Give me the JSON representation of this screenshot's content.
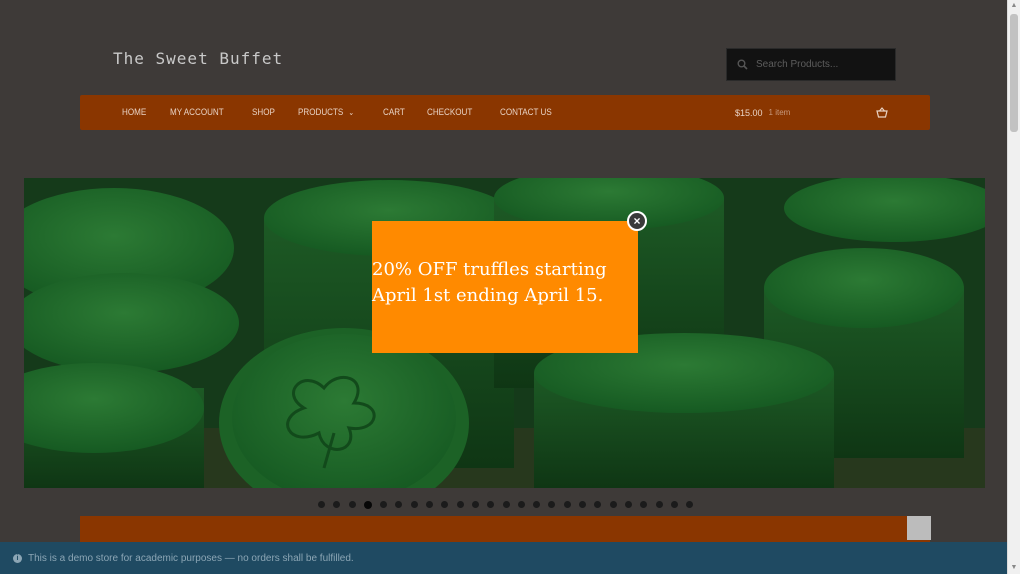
{
  "site": {
    "title": "The Sweet Buffet"
  },
  "search": {
    "placeholder": "Search Products..."
  },
  "nav": {
    "items": [
      {
        "label": "Home"
      },
      {
        "label": "My Account"
      },
      {
        "label": "Shop"
      },
      {
        "label": "Products"
      },
      {
        "label": "Cart"
      },
      {
        "label": "Checkout"
      },
      {
        "label": "Contact Us"
      }
    ]
  },
  "cart": {
    "total": "$15.00",
    "items": "1 item"
  },
  "slider": {
    "slide_count": 25,
    "active_index": 3
  },
  "popup": {
    "message": "20% OFF truffles starting April 1st ending April 15.",
    "close_symbol": "×"
  },
  "notice": {
    "text": "This is a demo store for academic purposes — no orders shall be fulfilled."
  },
  "colors": {
    "nav_bg": "#8a3600",
    "popup_bg": "#ff8a00",
    "notice_bg": "#1f4a62"
  }
}
